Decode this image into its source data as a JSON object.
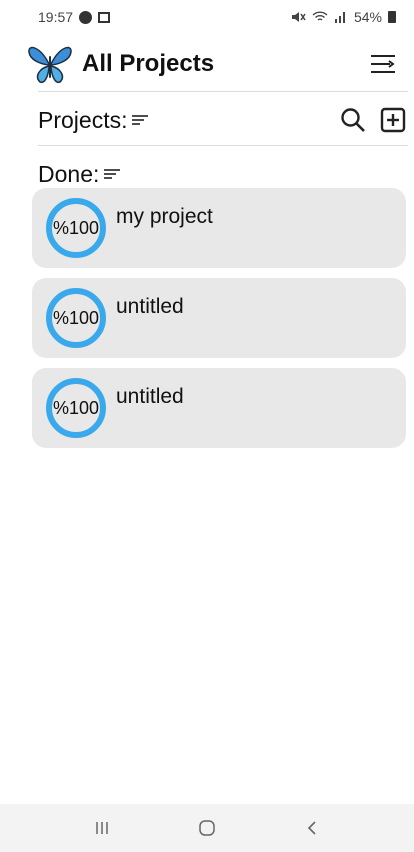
{
  "status": {
    "time": "19:57",
    "battery": "54%"
  },
  "header": {
    "title": "All Projects"
  },
  "projects": {
    "label": "Projects:"
  },
  "done": {
    "label": "Done:",
    "items": [
      {
        "percent": "%100",
        "title": "my project",
        "progress": 1.0
      },
      {
        "percent": "%100",
        "title": "untitled",
        "progress": 1.0
      },
      {
        "percent": "%100",
        "title": "untitled",
        "progress": 1.0
      }
    ]
  },
  "colors": {
    "accent": "#3aa9ec",
    "card_bg": "#e8e8e8"
  },
  "icons": [
    "butterfly-logo-icon",
    "menu-icon",
    "sort-icon",
    "search-icon",
    "add-box-icon",
    "recent-apps-icon",
    "home-icon",
    "back-icon"
  ]
}
